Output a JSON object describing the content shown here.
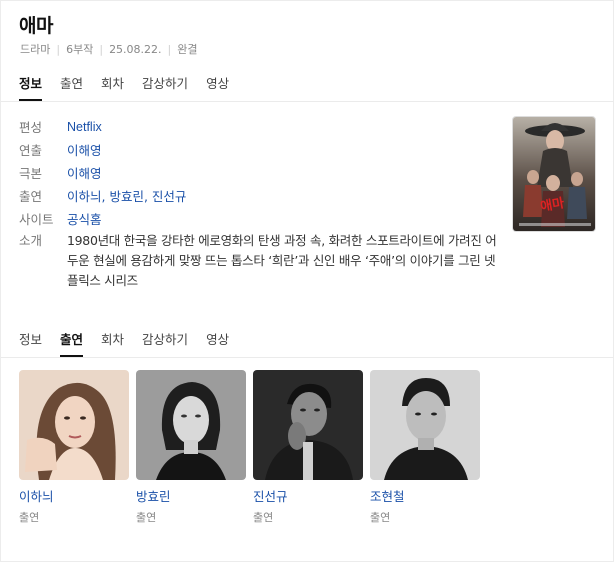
{
  "title": "애마",
  "meta": [
    "드라마",
    "6부작",
    "25.08.22.",
    "완결"
  ],
  "tabs": [
    "정보",
    "출연",
    "회차",
    "감상하기",
    "영상"
  ],
  "info": {
    "rows": [
      {
        "label": "편성",
        "value": "Netflix"
      },
      {
        "label": "연출",
        "value": "이해영"
      },
      {
        "label": "극본",
        "value": "이해영"
      },
      {
        "label": "출연",
        "value": "이하늬, 방효린, 진선규"
      },
      {
        "label": "사이트",
        "value": "공식홈"
      }
    ],
    "intro_label": "소개",
    "intro_text": "1980년대 한국을 강타한 에로영화의 탄생 과정 속, 화려한 스포트라이트에 가려진 어두운 현실에 용감하게 맞짱 뜨는 톱스타 ‘희란’과 신인 배우 ‘주애’의 이야기를 그린 넷플릭스 시리즈"
  },
  "cast": [
    {
      "name": "이하늬",
      "role": "출연"
    },
    {
      "name": "방효린",
      "role": "출연"
    },
    {
      "name": "진선규",
      "role": "출연"
    },
    {
      "name": "조현철",
      "role": "출연"
    }
  ]
}
